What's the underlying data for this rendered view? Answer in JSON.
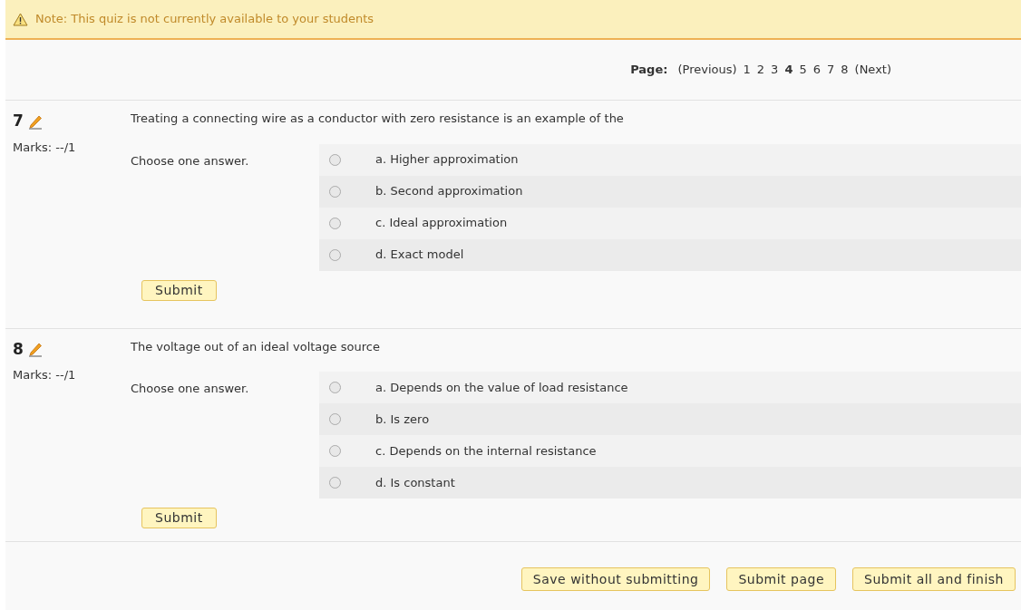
{
  "notice": "Note: This quiz is not currently available to your students",
  "paging": {
    "label": "Page:",
    "previous": "(Previous)",
    "next": "(Next)",
    "pages": [
      {
        "label": "1",
        "selected": false
      },
      {
        "label": "2",
        "selected": false
      },
      {
        "label": "3",
        "selected": false
      },
      {
        "label": "4",
        "selected": true
      },
      {
        "label": "5",
        "selected": false
      },
      {
        "label": "6",
        "selected": false
      },
      {
        "label": "7",
        "selected": false
      },
      {
        "label": "8",
        "selected": false
      }
    ]
  },
  "questions": [
    {
      "number": "7",
      "marks": "Marks: --/1",
      "text": "Treating a connecting wire as a conductor with zero resistance is an example of the",
      "prompt": "Choose one answer.",
      "submit": "Submit",
      "answers": [
        {
          "label": "a. Higher approximation",
          "selected": false
        },
        {
          "label": "b. Second approximation",
          "selected": false
        },
        {
          "label": "c. Ideal approximation",
          "selected": false
        },
        {
          "label": "d. Exact model",
          "selected": false
        }
      ]
    },
    {
      "number": "8",
      "marks": "Marks: --/1",
      "text": "The voltage out of an ideal voltage source",
      "prompt": "Choose one answer.",
      "submit": "Submit",
      "answers": [
        {
          "label": "a. Depends on the value of load resistance",
          "selected": false
        },
        {
          "label": "b. Is zero",
          "selected": false
        },
        {
          "label": "c. Depends on the internal resistance",
          "selected": false
        },
        {
          "label": "d. Is constant",
          "selected": false
        }
      ]
    }
  ],
  "actions": [
    "Save without submitting",
    "Submit page",
    "Submit all and finish"
  ]
}
